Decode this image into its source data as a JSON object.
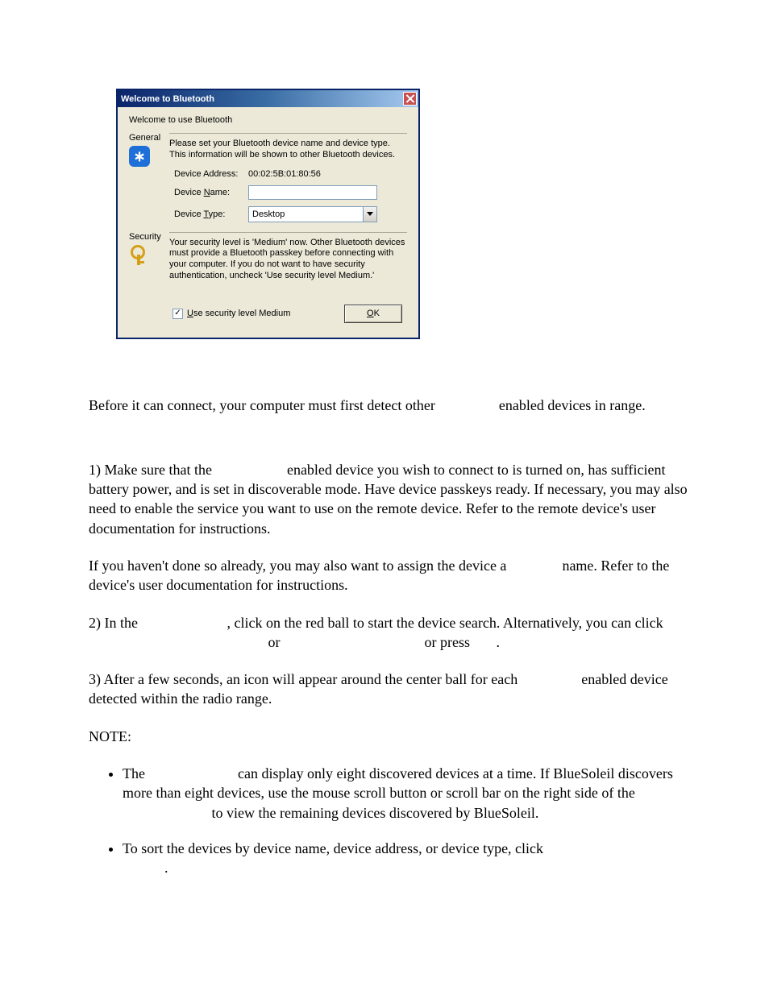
{
  "dialog": {
    "title": "Welcome to Bluetooth",
    "welcome": "Welcome to use Bluetooth",
    "general": {
      "heading": "General",
      "description": "Please set your Bluetooth device name and device type. This information will be shown to other Bluetooth devices.",
      "address_label": "Device Address:",
      "address_value": "00:02:5B:01:80:56",
      "name_label": "Device Name:",
      "name_value": "",
      "type_label": "Device Type:",
      "type_value": "Desktop"
    },
    "security": {
      "heading": "Security",
      "description": "Your security level is 'Medium' now. Other Bluetooth devices must provide a Bluetooth passkey before connecting with your computer. If you do not want to have security authentication, uncheck 'Use security level Medium.'",
      "checkbox_label": "Use security level Medium",
      "checkbox_checked": "✓"
    },
    "ok_label": "OK"
  },
  "doc": {
    "p1a": "Before it can connect, your computer must first detect other ",
    "p1b": " enabled devices in range.",
    "p2a": "1) Make sure that the ",
    "p2b": " enabled device you wish to connect to is turned on, has sufficient battery power, and is set in discoverable mode. Have device passkeys ready. If necessary, you may also need to enable the service you want to use on the remote device. Refer to the remote device's user documentation for instructions.",
    "p3a": "If you haven't done so already, you may also want to assign the device a ",
    "p3b": " name. Refer to the device's user documentation for instructions.",
    "p4a": "2) In the ",
    "p4b": ", click on the red ball to start the device search. Alternatively, you can click ",
    "p4c": " or ",
    "p4d": " or press ",
    "p4e": ".",
    "p5a": "3) After a few seconds, an icon will appear around the center ball for each ",
    "p5b": " enabled device detected within the radio range.",
    "note": "NOTE:",
    "li1a": "The ",
    "li1b": " can display only eight discovered devices at a time. If BlueSoleil discovers more than eight devices, use the mouse scroll button or scroll bar on the right side of the ",
    "li1c": " to view the remaining devices discovered by BlueSoleil.",
    "li2a": "To sort the devices by device name, device address, or device type, click ",
    "li2b": "."
  }
}
